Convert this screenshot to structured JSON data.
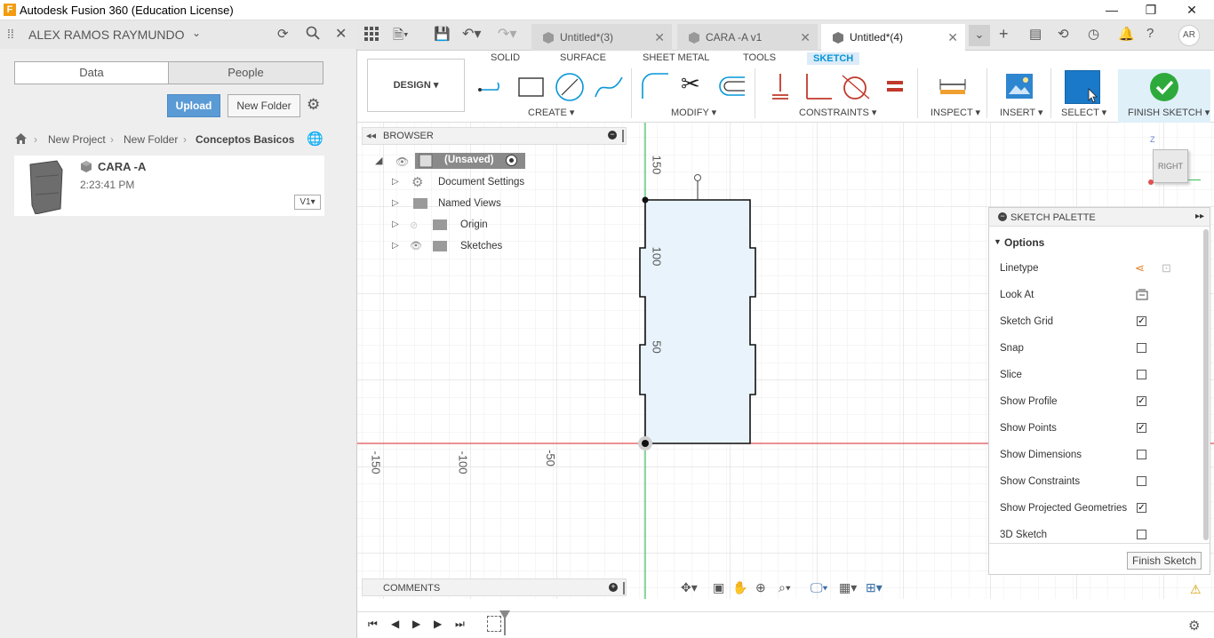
{
  "window": {
    "title": "Autodesk Fusion 360 (Education License)",
    "minimize": "—",
    "restore": "❐",
    "close": "✕"
  },
  "user": {
    "name": "ALEX RAMOS RAYMUNDO",
    "initials": "AR"
  },
  "left_panel": {
    "tabs": [
      "Data",
      "People"
    ],
    "upload_label": "Upload",
    "new_folder_label": "New Folder",
    "breadcrumb": [
      "New Project",
      "New Folder",
      "Conceptos Basicos"
    ],
    "file": {
      "name": "CARA -A",
      "time": "2:23:41 PM",
      "version": "V1▾"
    }
  },
  "doc_tabs": [
    {
      "label": "Untitled*(3)"
    },
    {
      "label": "CARA -A v1"
    },
    {
      "label": "Untitled*(4)"
    }
  ],
  "toolbar": {
    "workspace": "DESIGN ▾",
    "workspace_tabs": [
      "SOLID",
      "SURFACE",
      "SHEET METAL",
      "TOOLS",
      "SKETCH"
    ],
    "groups": [
      "CREATE ▾",
      "MODIFY ▾",
      "CONSTRAINTS ▾",
      "INSPECT ▾",
      "INSERT ▾",
      "SELECT ▾",
      "FINISH SKETCH ▾"
    ]
  },
  "browser": {
    "title": "BROWSER",
    "root": "(Unsaved)",
    "items": [
      "Document Settings",
      "Named Views",
      "Origin",
      "Sketches"
    ]
  },
  "axis_labels": {
    "v150": "150",
    "v100": "100",
    "v50": "50",
    "h150": "-150",
    "h100": "-100",
    "h50": "-50"
  },
  "viewcube": {
    "face": "RIGHT",
    "axis_z": "Z"
  },
  "palette": {
    "title": "SKETCH PALETTE",
    "section": "Options",
    "options": [
      {
        "label": "Linetype",
        "kind": "icons"
      },
      {
        "label": "Look At",
        "kind": "icon"
      },
      {
        "label": "Sketch Grid",
        "checked": true
      },
      {
        "label": "Snap",
        "checked": false
      },
      {
        "label": "Slice",
        "checked": false
      },
      {
        "label": "Show Profile",
        "checked": true
      },
      {
        "label": "Show Points",
        "checked": true
      },
      {
        "label": "Show Dimensions",
        "checked": false
      },
      {
        "label": "Show Constraints",
        "checked": false
      },
      {
        "label": "Show Projected Geometries",
        "checked": true
      },
      {
        "label": "3D Sketch",
        "checked": false
      }
    ],
    "finish_label": "Finish Sketch"
  },
  "comments": {
    "title": "COMMENTS"
  },
  "colors": {
    "accent": "#0696d7",
    "upload": "#5b9bd5",
    "finish_green": "#2eaa3c",
    "axis_red": "#e05050",
    "axis_green": "#3cc05a",
    "profile_fill": "#e8f3fb"
  }
}
